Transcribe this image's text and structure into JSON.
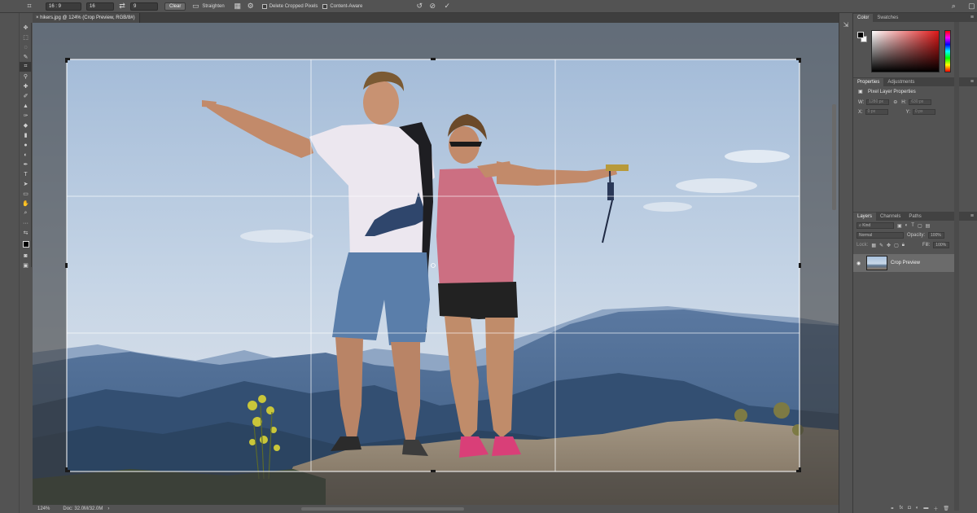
{
  "options_bar": {
    "ratio_value": "16 : 9",
    "width_value": "16",
    "swap_icon": "⇄",
    "height_value": "9",
    "clear_label": "Clear",
    "straighten_label": "Straighten",
    "delete_cropped_label": "Delete Cropped Pixels",
    "content_aware_label": "Content-Aware",
    "icons": [
      "crop-tool-icon",
      "grid-overlay-icon",
      "settings-gear-icon",
      "reset-icon",
      "cancel-icon",
      "commit-check-icon",
      "search-icon",
      "workspace-icon"
    ]
  },
  "document": {
    "tab_title": "hikers.jpg @ 124% (Crop Preview, RGB/8#)"
  },
  "status": {
    "zoom": "124%",
    "doc_size": "Doc: 32.0M/32.0M"
  },
  "color_panel": {
    "tabs": [
      "Color",
      "Swatches"
    ],
    "foreground": "#000000",
    "background": "#ffffff"
  },
  "properties_panel": {
    "tabs": [
      "Properties",
      "Adjustments"
    ],
    "title": "Pixel Layer Properties",
    "w_label": "W:",
    "w_value": "1280 px",
    "h_label": "H:",
    "h_value": "630 px",
    "x_label": "X:",
    "x_value": "0 px",
    "y_label": "Y:",
    "y_value": "0 px"
  },
  "layers_panel": {
    "tabs": [
      "Layers",
      "Channels",
      "Paths"
    ],
    "kind_placeholder": "Kind",
    "blend_mode": "Normal",
    "opacity_label": "Opacity:",
    "opacity_value": "100%",
    "lock_label": "Lock:",
    "fill_label": "Fill:",
    "fill_value": "100%",
    "layers": [
      {
        "name": "Crop Preview",
        "visible": true
      }
    ],
    "footer_icons": [
      "link-icon",
      "fx-icon",
      "mask-icon",
      "adjustment-icon",
      "group-icon",
      "new-layer-icon",
      "trash-icon"
    ]
  },
  "colors": {
    "ui_bg": "#535353",
    "ui_dark": "#3e3e3e",
    "accent": "#e01818"
  }
}
